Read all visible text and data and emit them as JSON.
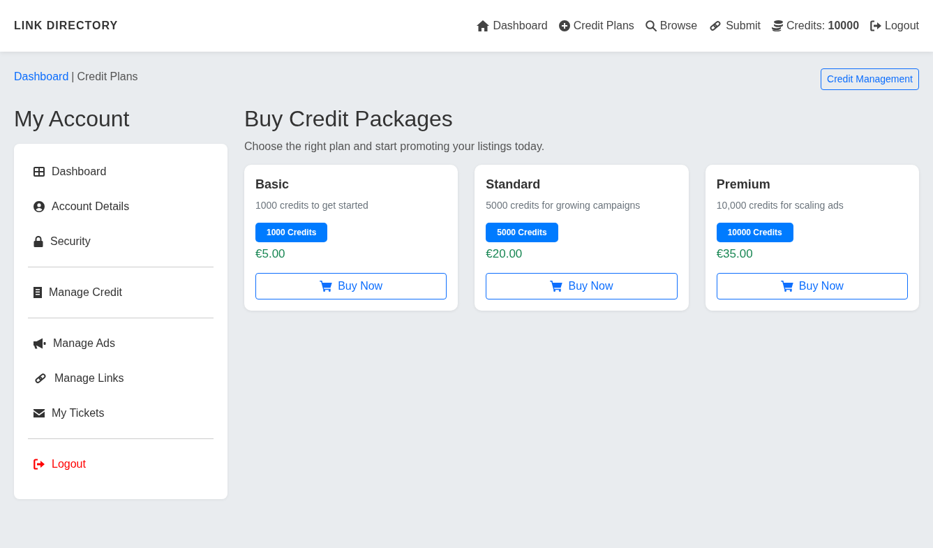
{
  "navbar": {
    "brand": "LINK DIRECTORY",
    "links": [
      {
        "label": "Dashboard"
      },
      {
        "label": "Credit Plans"
      },
      {
        "label": "Browse"
      },
      {
        "label": "Submit"
      },
      {
        "label": "Credits: **10000**"
      },
      {
        "label": "Logout"
      }
    ]
  },
  "breadcrumb": {
    "items": [
      {
        "label": "Dashboard",
        "kind": "link"
      },
      {
        "label": "Credit Plans",
        "kind": "current"
      }
    ],
    "separator": "|"
  },
  "header_button": "Credit Management",
  "sidebar": {
    "title": "My Account",
    "groups": [
      [
        {
          "label": "Dashboard",
          "kind": "link"
        },
        {
          "label": "Account Details",
          "kind": "link"
        },
        {
          "label": "Security",
          "kind": "link"
        }
      ],
      [
        {
          "label": "Manage Credit",
          "kind": "link"
        }
      ],
      [
        {
          "label": "Manage Ads",
          "kind": "link"
        },
        {
          "label": "Manage Links",
          "kind": "link"
        },
        {
          "label": "My Tickets",
          "kind": "link"
        }
      ],
      [
        {
          "label": "Logout",
          "kind": "danger"
        }
      ]
    ]
  },
  "main": {
    "title": "Buy Credit Packages",
    "subtitle": "Choose the right plan and start promoting your listings today.",
    "plans": [
      {
        "name": "Basic",
        "description": "1000 credits to get started",
        "badge": "1000 Credits",
        "price": "€5.00",
        "button": "Buy Now"
      },
      {
        "name": "Standard",
        "description": "5000 credits for growing campaigns",
        "badge": "5000 Credits",
        "price": "€20.00",
        "button": "Buy Now"
      },
      {
        "name": "Premium",
        "description": "10,000 credits for scaling ads",
        "badge": "10000 Credits",
        "price": "€35.00",
        "button": "Buy Now"
      }
    ]
  }
}
